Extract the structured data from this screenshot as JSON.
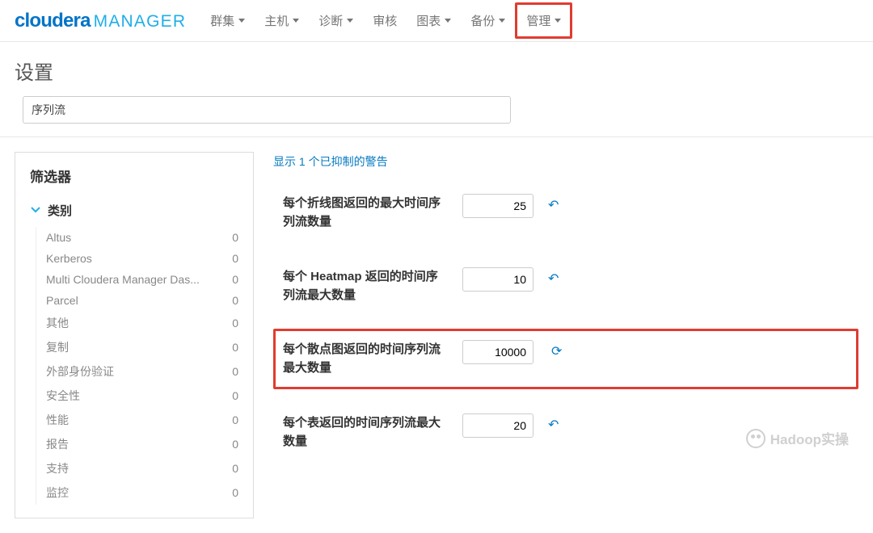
{
  "brand": {
    "cloudera": "cloudera",
    "manager": "MANAGER"
  },
  "nav": {
    "items": [
      {
        "label": "群集"
      },
      {
        "label": "主机"
      },
      {
        "label": "诊断"
      },
      {
        "label": "审核"
      },
      {
        "label": "图表"
      },
      {
        "label": "备份"
      },
      {
        "label": "管理"
      }
    ]
  },
  "page": {
    "title": "设置"
  },
  "search": {
    "value": "序列流"
  },
  "filter": {
    "title": "筛选器",
    "section_label": "类别",
    "categories": [
      {
        "label": "Altus",
        "count": "0"
      },
      {
        "label": "Kerberos",
        "count": "0"
      },
      {
        "label": "Multi Cloudera Manager Das...",
        "count": "0"
      },
      {
        "label": "Parcel",
        "count": "0"
      },
      {
        "label": "其他",
        "count": "0"
      },
      {
        "label": "复制",
        "count": "0"
      },
      {
        "label": "外部身份验证",
        "count": "0"
      },
      {
        "label": "安全性",
        "count": "0"
      },
      {
        "label": "性能",
        "count": "0"
      },
      {
        "label": "报告",
        "count": "0"
      },
      {
        "label": "支持",
        "count": "0"
      },
      {
        "label": "监控",
        "count": "0"
      }
    ]
  },
  "main": {
    "suppressed_warning": "显示 1 个已抑制的警告",
    "settings": [
      {
        "label": "每个折线图返回的最大时间序列流数量",
        "value": "25"
      },
      {
        "label": "每个 Heatmap 返回的时间序列流最大数量",
        "value": "10"
      },
      {
        "label": "每个散点图返回的时间序列流最大数量",
        "value": "10000"
      },
      {
        "label": "每个表返回的时间序列流最大数量",
        "value": "20"
      }
    ]
  },
  "watermark": {
    "text": "Hadoop实操"
  }
}
